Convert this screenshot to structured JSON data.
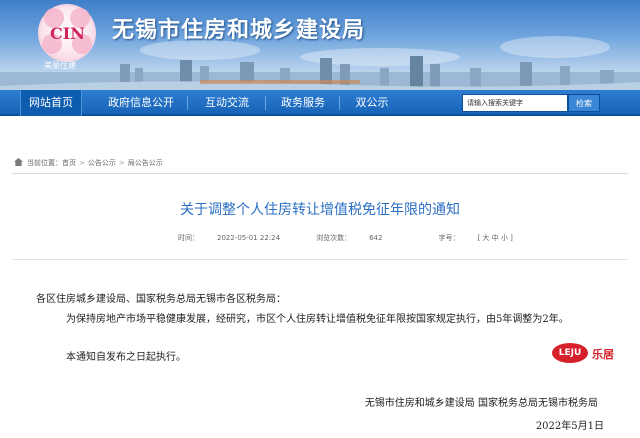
{
  "header": {
    "logo_text": "CIN",
    "logo_sub": "美丽住建",
    "site_title": "无锡市住房和城乡建设局"
  },
  "nav": {
    "items": [
      {
        "label": "网站首页"
      },
      {
        "label": "政府信息公开"
      },
      {
        "label": "互动交流"
      },
      {
        "label": "政务服务"
      },
      {
        "label": "双公示"
      }
    ],
    "search_placeholder": "请输入搜索关键字",
    "search_button": "检索"
  },
  "breadcrumb": {
    "prefix": "当前位置：",
    "items": [
      "首页",
      "公告公示",
      "局公告公示"
    ]
  },
  "article": {
    "title": "关于调整个人住房转让增值税免征年限的通知",
    "time_label": "时间：",
    "time": "2022-05-01 22:24",
    "views_label": "浏览次数：",
    "views": "642",
    "font_label": "字号：",
    "font_options": "[ 大 中 小 ]",
    "salutation": "各区住房城乡建设局、国家税务总局无锡市各区税务局：",
    "paragraph1": "为保持房地产市场平稳健康发展，经研究，市区个人住房转让增值税免征年限按国家规定执行，由5年调整为2年。",
    "paragraph2": "本通知自发布之日起执行。",
    "signatories": "无锡市住房和城乡建设局    国家税务总局无锡市税务局",
    "date": "2022年5月1日"
  },
  "watermark": {
    "logo_text": "LEJU",
    "brand": "乐居"
  }
}
